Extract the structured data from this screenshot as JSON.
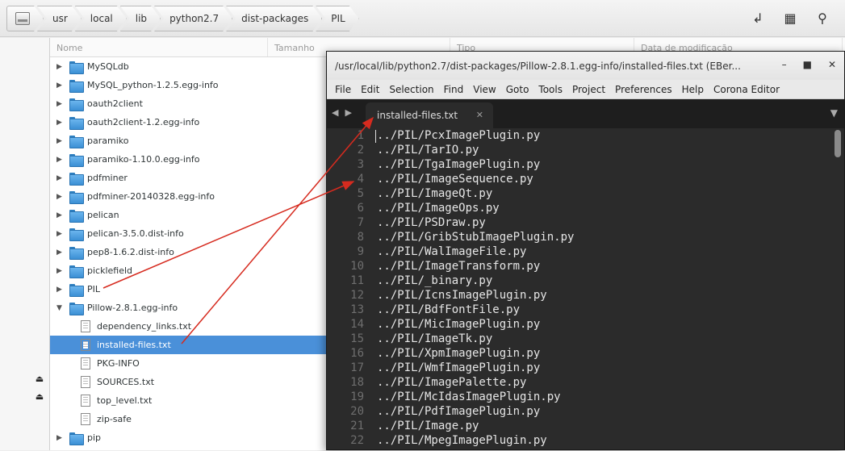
{
  "pathbar": {
    "crumbs": [
      "usr",
      "local",
      "lib",
      "python2.7",
      "dist-packages",
      "PIL"
    ]
  },
  "columns": [
    "Nome",
    "Tamanho",
    "Tipo",
    "Data de modificação"
  ],
  "files": [
    {
      "name": "MySQLdb",
      "kind": "folder"
    },
    {
      "name": "MySQL_python-1.2.5.egg-info",
      "kind": "folder"
    },
    {
      "name": "oauth2client",
      "kind": "folder"
    },
    {
      "name": "oauth2client-1.2.egg-info",
      "kind": "folder"
    },
    {
      "name": "paramiko",
      "kind": "folder"
    },
    {
      "name": "paramiko-1.10.0.egg-info",
      "kind": "folder"
    },
    {
      "name": "pdfminer",
      "kind": "folder"
    },
    {
      "name": "pdfminer-20140328.egg-info",
      "kind": "folder"
    },
    {
      "name": "pelican",
      "kind": "folder"
    },
    {
      "name": "pelican-3.5.0.dist-info",
      "kind": "folder"
    },
    {
      "name": "pep8-1.6.2.dist-info",
      "kind": "folder"
    },
    {
      "name": "picklefield",
      "kind": "folder"
    },
    {
      "name": "PIL",
      "kind": "folder"
    },
    {
      "name": "Pillow-2.8.1.egg-info",
      "kind": "folder-open"
    },
    {
      "name": "dependency_links.txt",
      "kind": "file"
    },
    {
      "name": "installed-files.txt",
      "kind": "file",
      "selected": true
    },
    {
      "name": "PKG-INFO",
      "kind": "file"
    },
    {
      "name": "SOURCES.txt",
      "kind": "file"
    },
    {
      "name": "top_level.txt",
      "kind": "file"
    },
    {
      "name": "zip-safe",
      "kind": "file"
    },
    {
      "name": "pip",
      "kind": "folder"
    }
  ],
  "editor": {
    "title": "/usr/local/lib/python2.7/dist-packages/Pillow-2.8.1.egg-info/installed-files.txt (EBer...",
    "menu": [
      "File",
      "Edit",
      "Selection",
      "Find",
      "View",
      "Goto",
      "Tools",
      "Project",
      "Preferences",
      "Help",
      "Corona Editor"
    ],
    "tab_label": "installed-files.txt",
    "lines": [
      "../PIL/PcxImagePlugin.py",
      "../PIL/TarIO.py",
      "../PIL/TgaImagePlugin.py",
      "../PIL/ImageSequence.py",
      "../PIL/ImageQt.py",
      "../PIL/ImageOps.py",
      "../PIL/PSDraw.py",
      "../PIL/GribStubImagePlugin.py",
      "../PIL/WalImageFile.py",
      "../PIL/ImageTransform.py",
      "../PIL/_binary.py",
      "../PIL/IcnsImagePlugin.py",
      "../PIL/BdfFontFile.py",
      "../PIL/MicImagePlugin.py",
      "../PIL/ImageTk.py",
      "../PIL/XpmImagePlugin.py",
      "../PIL/WmfImagePlugin.py",
      "../PIL/ImagePalette.py",
      "../PIL/McIdasImagePlugin.py",
      "../PIL/PdfImagePlugin.py",
      "../PIL/Image.py",
      "../PIL/MpegImagePlugin.py"
    ]
  },
  "colors": {
    "selection": "#4a90d9",
    "annotation_arrow": "#d62b1f"
  }
}
